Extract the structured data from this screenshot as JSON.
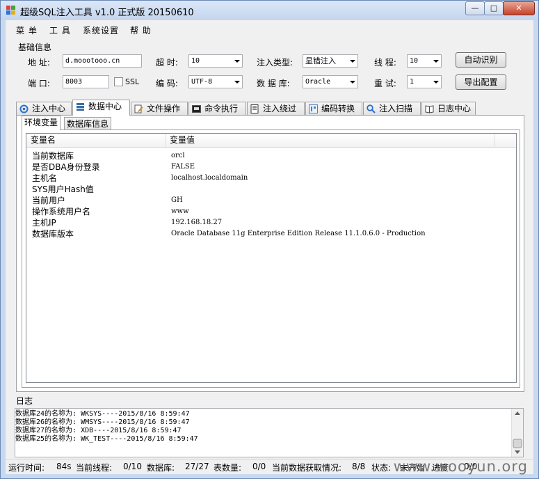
{
  "window": {
    "title": "超级SQL注入工具 v1.0 正式版 20150610",
    "controls": {
      "minimize": "—",
      "maximize": "□",
      "close": "✕"
    }
  },
  "menu": [
    "菜 单",
    "工 具",
    "系统设置",
    "帮 助"
  ],
  "basic_info": {
    "group_title": "基础信息",
    "address_label": "地 址:",
    "address_value": "d.moootooo.cn",
    "port_label": "端 口:",
    "port_value": "8003",
    "ssl_label": "SSL",
    "timeout_label": "超 时:",
    "timeout_value": "10",
    "encoding_label": "编 码:",
    "encoding_value": "UTF-8",
    "inject_type_label": "注入类型:",
    "inject_type_value": "显错注入",
    "database_label": "数 据 库:",
    "database_value": "Oracle",
    "threads_label": "线 程:",
    "threads_value": "10",
    "retry_label": "重 试:",
    "retry_value": "1",
    "auto_detect_button": "自动识别",
    "export_config_button": "导出配置"
  },
  "tabs": [
    "注入中心",
    "数据中心",
    "文件操作",
    "命令执行",
    "注入绕过",
    "编码转换",
    "注入扫描",
    "日志中心"
  ],
  "subtabs": [
    "环境变量",
    "数据库信息"
  ],
  "table": {
    "columns": [
      "变量名",
      "变量值"
    ],
    "rows": [
      {
        "name": "当前数据库",
        "value": "orcl"
      },
      {
        "name": "是否DBA身份登录",
        "value": "FALSE"
      },
      {
        "name": "主机名",
        "value": "localhost.localdomain"
      },
      {
        "name": "SYS用户Hash值",
        "value": ""
      },
      {
        "name": "当前用户",
        "value": "GH"
      },
      {
        "name": "操作系统用户名",
        "value": "www"
      },
      {
        "name": "主机IP",
        "value": "192.168.18.27"
      },
      {
        "name": "数据库版本",
        "value": "Oracle Database 11g Enterprise Edition Release 11.1.0.6.0 - Production"
      }
    ]
  },
  "log": {
    "title": "日志",
    "lines": [
      "数据库24的名称为: WKSYS----2015/8/16 8:59:47",
      "数据库26的名称为: WMSYS----2015/8/16 8:59:47",
      "数据库27的名称为: XDB----2015/8/16 8:59:47",
      "数据库25的名称为: WK_TEST----2015/8/16 8:59:47"
    ]
  },
  "status": {
    "runtime_label": "运行时间:",
    "runtime_value": "84s",
    "threads_label": "当前线程:",
    "threads_value": "0/10",
    "db_label": "数据库:",
    "db_value": "27/27",
    "tables_label": "表数量:",
    "tables_value": "0/0",
    "fetch_label": "当前数据获取情况:",
    "fetch_value": "8/8",
    "state_label": "状态:",
    "state_value": "未开始",
    "progress_label": "进度:",
    "progress_value": "0/0"
  },
  "watermark": "www.wooyun.org"
}
